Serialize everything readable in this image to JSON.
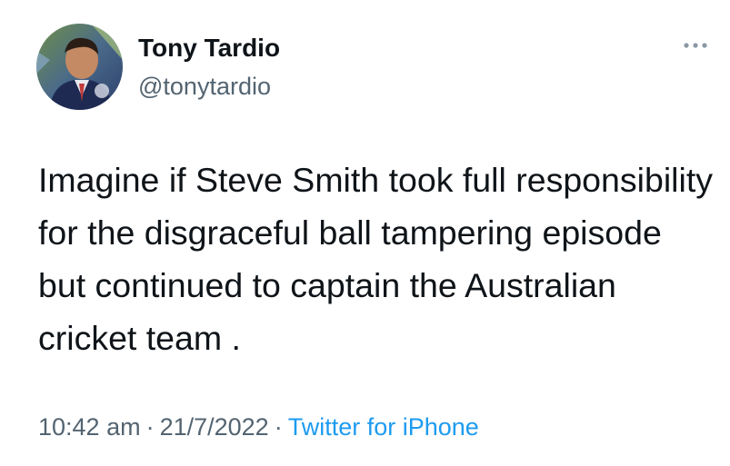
{
  "author": {
    "name": "Tony Tardio",
    "handle": "@tonytardio"
  },
  "tweet": {
    "text": "Imagine if Steve Smith took full responsibility for the disgraceful ball tampering episode but continued to captain the Australian cricket team .",
    "time": "10:42 am",
    "separator": "·",
    "date": "21/7/2022",
    "source": "Twitter for iPhone"
  },
  "icons": {
    "more": "more-horizontal-icon",
    "avatar": "profile-photo"
  },
  "colors": {
    "text": "#0f1419",
    "secondary": "#536471",
    "link": "#1d9bf0",
    "background": "#ffffff"
  }
}
